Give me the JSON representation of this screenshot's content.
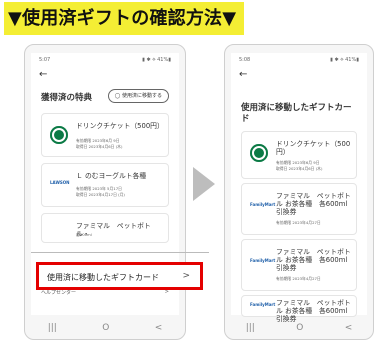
{
  "header": {
    "title": "▼使用済ギフトの確認方法▼"
  },
  "left_phone": {
    "status": {
      "time": "5:07",
      "icons": "▮ ✱ ⟡ 41%▮"
    },
    "back": "←",
    "page_title": "獲得済の特典",
    "move_used_button": "使用済に移動する",
    "cards": [
      {
        "logo": "starbucks",
        "name": "ドリンクチケット（500円）",
        "meta1": "有効期限 2023年6月 9日",
        "meta2": "取得日 2023年4月6日 (木)"
      },
      {
        "logo": "LAWSON",
        "name": "Ｌ のむヨーグルト各種",
        "meta1": "有効期限 2023年 5月17日",
        "meta2": "取得日 2023年4月17日 (月)"
      },
      {
        "logo": "",
        "name": "ファミマル　ペットボトル・",
        "meta1": "各500ml",
        "meta2": ""
      }
    ],
    "help": "ヘルプセンター",
    "help_arrow": ">",
    "nav": [
      "|||",
      "O",
      "<"
    ]
  },
  "callout": {
    "text": "使用済に移動したギフトカード",
    "arrow": ">"
  },
  "right_phone": {
    "status": {
      "time": "5:08",
      "icons": "▮ ✱ ⟡ 41%▮"
    },
    "back": "←",
    "page_title": "使用済に移動したギフトカード",
    "cards": [
      {
        "logo": "starbucks",
        "name": "ドリンクチケット（500円）",
        "meta1": "有効期限 2023年6月 9日",
        "meta2": "取得日 2023年4月6日 (木)"
      },
      {
        "logo": "FamilyMart",
        "name": "ファミマル　ペットボトル お茶各種　各600ml引換券",
        "meta1": "有効期限 2023年4月27日",
        "meta2": ""
      },
      {
        "logo": "FamilyMart",
        "name": "ファミマル　ペットボトル お茶各種　各600ml引換券",
        "meta1": "有効期限 2023年4月27日",
        "meta2": ""
      },
      {
        "logo": "FamilyMart",
        "name": "ファミマル　ペットボトル お茶各種　各600ml引換券",
        "meta1": "",
        "meta2": ""
      }
    ],
    "nav": [
      "|||",
      "O",
      "<"
    ]
  }
}
